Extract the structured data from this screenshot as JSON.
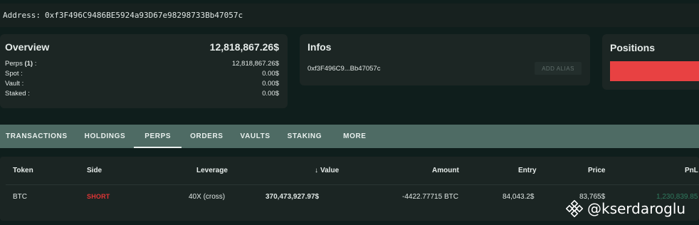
{
  "address": {
    "label": "Address:",
    "value": "0xf3F496C9486BE5924a93D67e98298733Bb47057c"
  },
  "overview": {
    "title": "Overview",
    "total": "12,818,867.26$",
    "rows": [
      {
        "label": "Perps",
        "suffix": " (1)",
        "colon": " :",
        "value": "12,818,867.26$"
      },
      {
        "label": "Spot :",
        "value": "0.00$"
      },
      {
        "label": "Vault :",
        "value": "0.00$"
      },
      {
        "label": "Staked :",
        "value": "0.00$"
      }
    ]
  },
  "infos": {
    "title": "Infos",
    "address_short": "0xf3F496C9...Bb47057c",
    "alias_button": "ADD ALIAS"
  },
  "positions": {
    "title": "Positions",
    "bar_color": "#e84142"
  },
  "tabs": [
    "TRANSACTIONS",
    "HOLDINGS",
    "PERPS",
    "ORDERS",
    "VAULTS",
    "STAKING",
    "MORE"
  ],
  "active_tab": "PERPS",
  "table": {
    "headers": {
      "token": "Token",
      "side": "Side",
      "leverage": "Leverage",
      "value": "Value",
      "amount": "Amount",
      "entry": "Entry",
      "price": "Price",
      "pnl": "PnL"
    },
    "sort_icon": "arrow-down-icon",
    "rows": [
      {
        "token": "BTC",
        "side": "SHORT",
        "leverage": "40X (cross)",
        "value": "370,473,927.97$",
        "amount": "-4422.77715 BTC",
        "entry": "84,043.2$",
        "price": "83,765$",
        "pnl": "1,230,839.85"
      }
    ]
  },
  "watermark": {
    "text": "@kserdaroglu",
    "icon": "binance-logo-icon"
  },
  "colors": {
    "short": "#e03535",
    "tabs_bg": "#4e6b64",
    "page_bg": "#0f1e1c"
  }
}
